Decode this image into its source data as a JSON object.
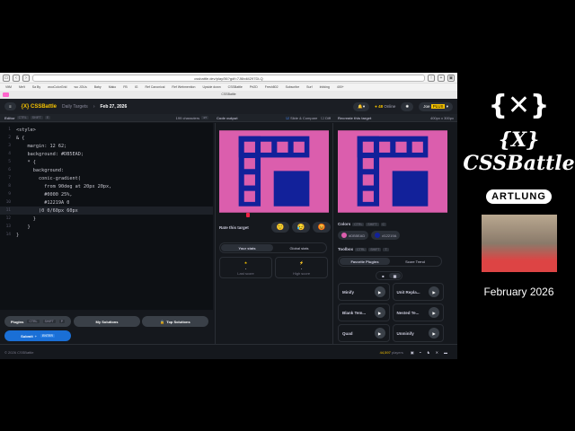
{
  "browser": {
    "url": "cssbattle.dev/play/56?gdf=7J6bdi4297DLQ",
    "tab": "CSSBattle",
    "bookmarks": [
      "VitM",
      "Me!t",
      "Sa By",
      "wooColorGrid",
      "wo JOUs",
      "Baby",
      "Mako",
      "FB",
      "IG",
      "Ref Canonical",
      "Ref Webmention",
      "Upside down",
      "CSSBattle",
      "Prt2D",
      "Fresh802",
      "Subscribe",
      "Surf",
      "Inbking",
      "400+"
    ]
  },
  "header": {
    "logo": "{X} CSSBattle",
    "crumb": "Daily Targets",
    "date": "Feb 27, 2026",
    "online": "48",
    "online_label": "Online",
    "user": "Joe",
    "badge": "PLUS"
  },
  "editor": {
    "label": "Editor",
    "shortcut": [
      "CTRL",
      "SHIFT",
      "E"
    ],
    "chars": "199 characters",
    "lines": [
      [
        "1",
        "<style>"
      ],
      [
        "2",
        "& {"
      ],
      [
        "3",
        "    margin: 12 62;"
      ],
      [
        "4",
        "    background: #DB5EAD;"
      ],
      [
        "5",
        "    * {"
      ],
      [
        "6",
        "      background:"
      ],
      [
        "7",
        "        conic-gradient("
      ],
      [
        "8",
        "          from 90deg at 20px 20px,"
      ],
      [
        "9",
        "          #0000 25%,"
      ],
      [
        "10",
        "          #12219A 0"
      ],
      [
        "11",
        "        )0 0/60px 60px"
      ],
      [
        "12",
        "      }"
      ],
      [
        "13",
        "    }"
      ],
      [
        "14",
        "}"
      ]
    ]
  },
  "buttons": {
    "plugins": "Plugins",
    "plugins_kbd": [
      "CTRL",
      "SHIFT",
      "P"
    ],
    "solutions": "My Solutions",
    "top": "Top Solutions",
    "submit": "Submit",
    "submit_kbd": "ENTER"
  },
  "output": {
    "label": "Code output",
    "slide": "Slide & Compare",
    "diff": "Diff"
  },
  "target": {
    "label": "Recreate this target",
    "size": "400px x 300px"
  },
  "rate": {
    "label": "Rate this target"
  },
  "stats": {
    "tabs": [
      "Your stats",
      "Global stats"
    ],
    "last_value": "-",
    "last": "Last score",
    "high_value": "-",
    "high": "High score"
  },
  "colors": {
    "label": "Colors",
    "kbd": [
      "CTRL",
      "SHIFT",
      "C"
    ],
    "items": [
      "#DB5EAD",
      "#12219A"
    ]
  },
  "toolbox": {
    "label": "Toolbox",
    "kbd": [
      "CTRL",
      "SHIFT",
      "T"
    ],
    "tabs": [
      "Favorite Plugins",
      "Score Trend"
    ],
    "plugins": [
      "Minify",
      "Unit Repla...",
      "Blank Tem...",
      "Nested Te...",
      "Quad",
      "Unminify"
    ]
  },
  "footer": {
    "copyright": "© 2026 CSSBattle",
    "players": "44,597",
    "players_label": "players"
  },
  "side": {
    "logo": "{X} CSSBattle",
    "artlung": "ARTLUNG",
    "date": "February 2026"
  }
}
